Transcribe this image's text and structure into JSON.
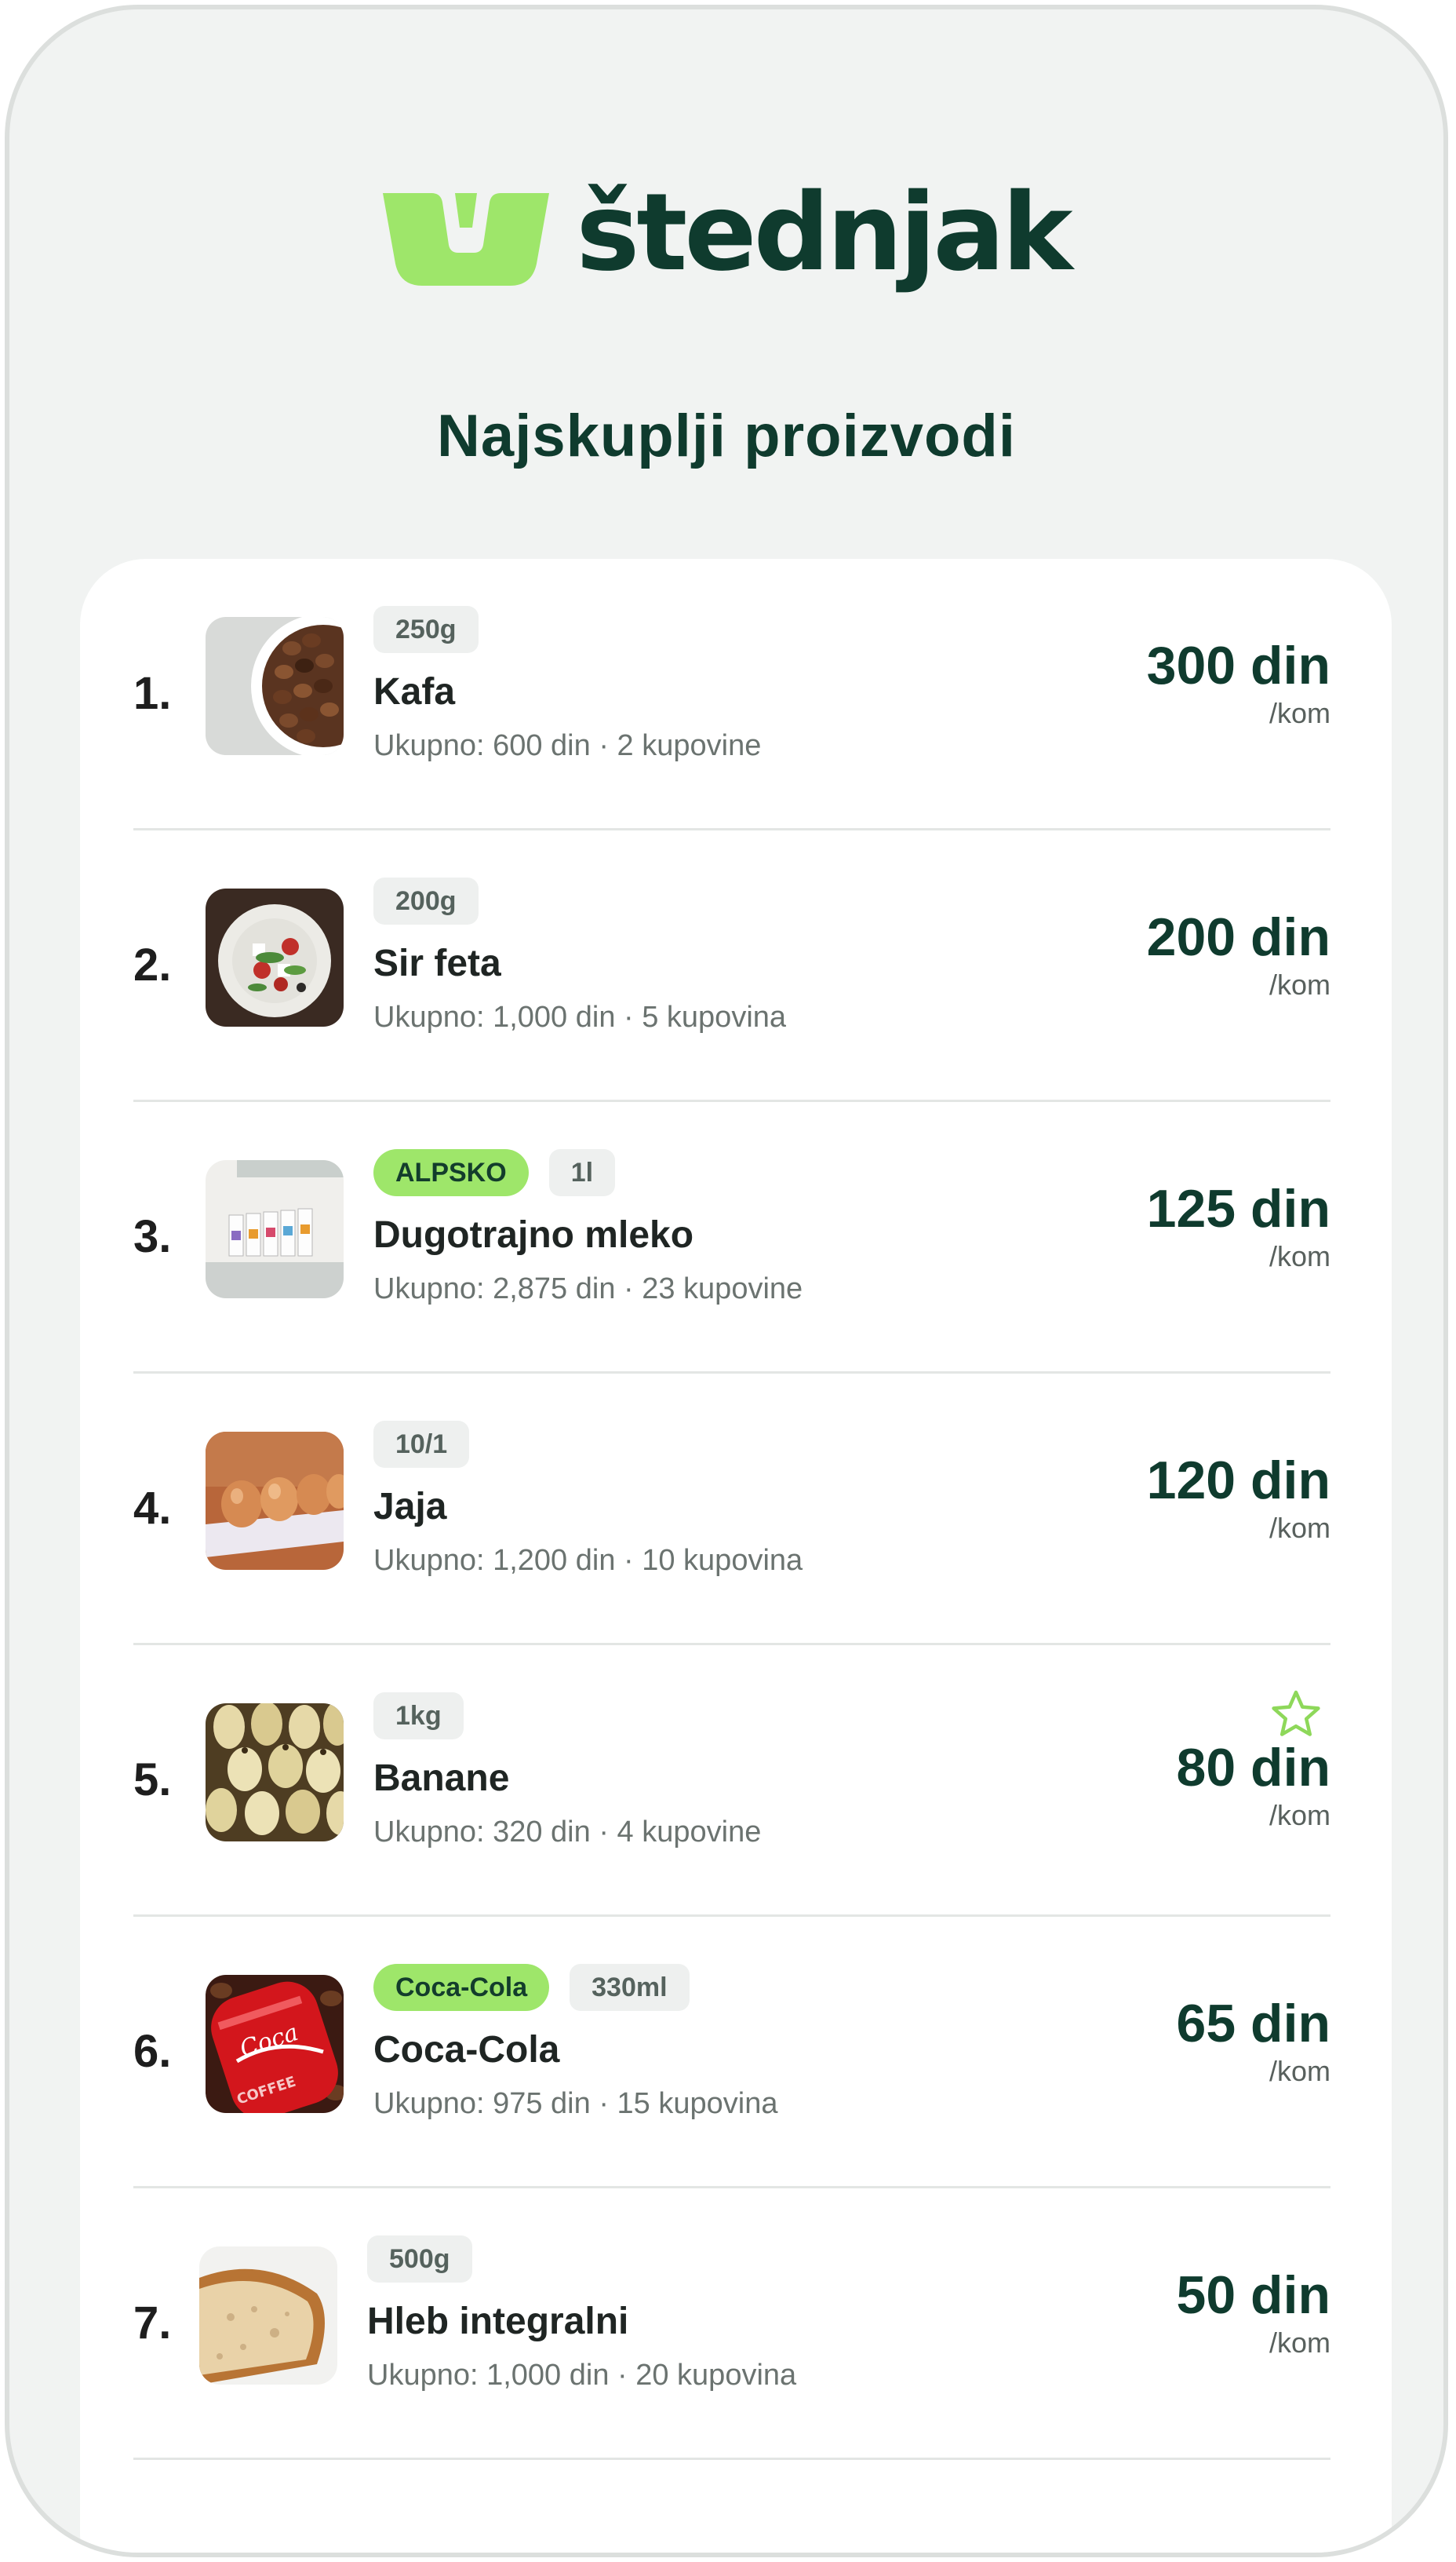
{
  "brand": {
    "name": "štednjak",
    "accent": "#9ee66a",
    "primary": "#0f3b2e"
  },
  "page_title": "Najskuplji proizvodi",
  "products": [
    {
      "rank": "1.",
      "tags": [
        "250g"
      ],
      "brand_tag": "",
      "name": "Kafa",
      "meta": "Ukupno: 600 din · 2 kupovine",
      "price": "300 din",
      "unit": "/kom",
      "favorite": false,
      "image": "coffee-beans"
    },
    {
      "rank": "2.",
      "tags": [
        "200g"
      ],
      "brand_tag": "",
      "name": "Sir feta",
      "meta": "Ukupno: 1,000 din · 5 kupovina",
      "price": "200 din",
      "unit": "/kom",
      "favorite": false,
      "image": "feta-salad"
    },
    {
      "rank": "3.",
      "tags": [
        "1l"
      ],
      "brand_tag": "ALPSKO",
      "name": "Dugotrajno mleko",
      "meta": "Ukupno: 2,875 din · 23 kupovine",
      "price": "125 din",
      "unit": "/kom",
      "favorite": false,
      "image": "milk-cartons"
    },
    {
      "rank": "4.",
      "tags": [
        "10/1"
      ],
      "brand_tag": "",
      "name": "Jaja",
      "meta": "Ukupno: 1,200 din · 10 kupovina",
      "price": "120 din",
      "unit": "/kom",
      "favorite": false,
      "image": "eggs"
    },
    {
      "rank": "5.",
      "tags": [
        "1kg"
      ],
      "brand_tag": "",
      "name": "Banane",
      "meta": "Ukupno: 320 din · 4 kupovine",
      "price": "80 din",
      "unit": "/kom",
      "favorite": true,
      "image": "bananas"
    },
    {
      "rank": "6.",
      "tags": [
        "330ml"
      ],
      "brand_tag": "Coca-Cola",
      "name": "Coca-Cola",
      "meta": "Ukupno: 975 din · 15 kupovina",
      "price": "65 din",
      "unit": "/kom",
      "favorite": false,
      "image": "coca-cola-can"
    },
    {
      "rank": "7.",
      "tags": [
        "500g"
      ],
      "brand_tag": "",
      "name": "Hleb integralni",
      "meta": "Ukupno: 1,000 din · 20 kupovina",
      "price": "50 din",
      "unit": "/kom",
      "favorite": false,
      "image": "bread"
    }
  ]
}
